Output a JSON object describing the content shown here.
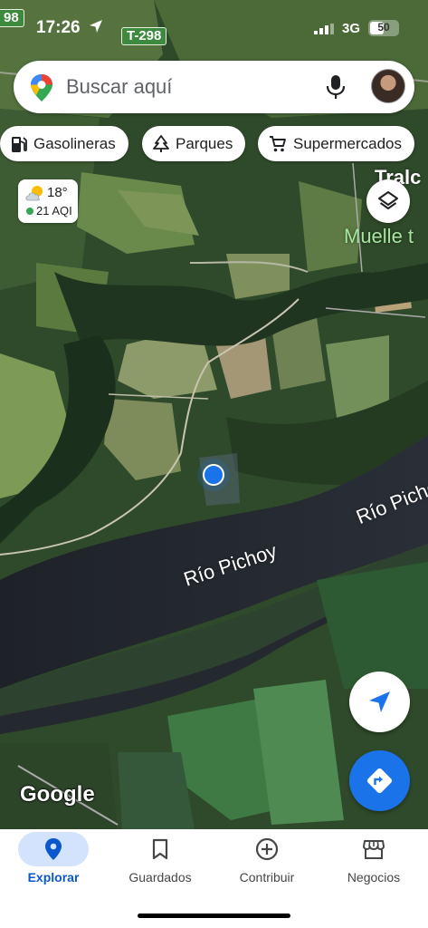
{
  "status_bar": {
    "time": "17:26",
    "network": "3G",
    "battery": "50",
    "battery_level_percent": 50
  },
  "map_labels": {
    "route_top_left": "98",
    "route_top": "T-298",
    "river_label_1": "Río Pichoy",
    "river_label_2": "Río Pichoy",
    "place_partial_1": "Tralc",
    "place_partial_2": "Muelle t",
    "attribution": "Google"
  },
  "search": {
    "placeholder": "Buscar aquí",
    "icons": [
      "maps-pin-icon",
      "mic-icon",
      "avatar"
    ]
  },
  "chips": [
    {
      "label": "Gasolineras",
      "icon": "gas-station-icon"
    },
    {
      "label": "Parques",
      "icon": "tree-icon"
    },
    {
      "label": "Supermercados",
      "icon": "cart-icon"
    }
  ],
  "weather": {
    "temp": "18°",
    "aqi": "21 AQI",
    "icon": "partly-cloudy-icon",
    "aqi_color": "#34a853"
  },
  "bottom_nav": {
    "tabs": [
      {
        "label": "Explorar",
        "icon": "explore-pin-icon",
        "active": true
      },
      {
        "label": "Guardados",
        "icon": "bookmark-icon",
        "active": false
      },
      {
        "label": "Contribuir",
        "icon": "add-circle-icon",
        "active": false
      },
      {
        "label": "Negocios",
        "icon": "storefront-icon",
        "active": false
      }
    ]
  },
  "colors": {
    "accent": "#1a73e8",
    "active_tab": "#0b57d0",
    "active_tab_bg": "#d3e3fd"
  }
}
